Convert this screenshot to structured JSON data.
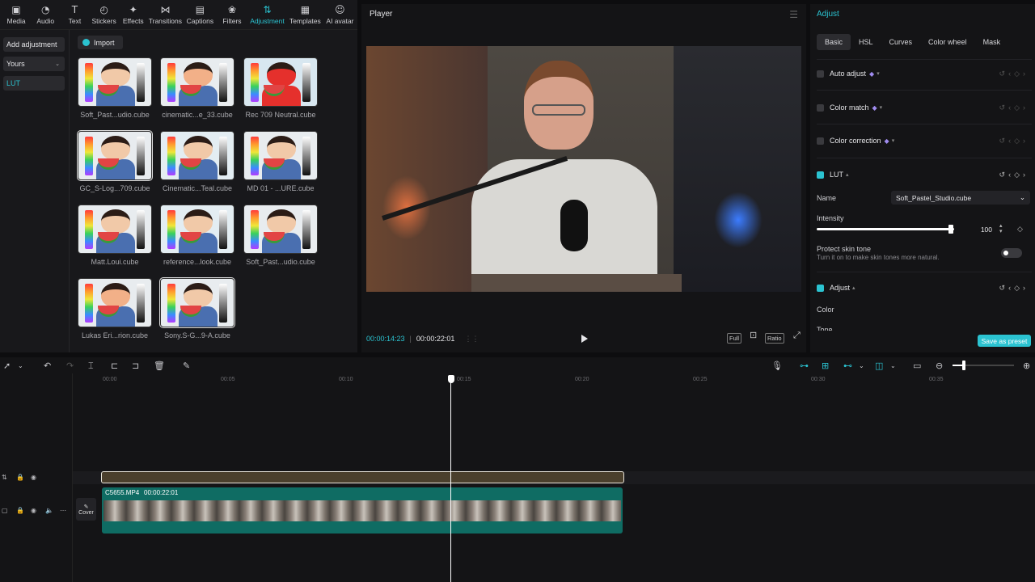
{
  "toolbar": {
    "items": [
      {
        "label": "Media",
        "icon": "▣"
      },
      {
        "label": "Audio",
        "icon": "◔"
      },
      {
        "label": "Text",
        "icon": "T"
      },
      {
        "label": "Stickers",
        "icon": "◴"
      },
      {
        "label": "Effects",
        "icon": "✦"
      },
      {
        "label": "Transitions",
        "icon": "⋈"
      },
      {
        "label": "Captions",
        "icon": "▤"
      },
      {
        "label": "Filters",
        "icon": "❀"
      },
      {
        "label": "Adjustment",
        "icon": "⇅"
      },
      {
        "label": "Templates",
        "icon": "▦"
      },
      {
        "label": "AI avatar",
        "icon": "☺"
      }
    ],
    "active": "Adjustment"
  },
  "left_panel": {
    "add_adjustment": "Add adjustment",
    "yours": "Yours",
    "lut": "LUT",
    "import": "Import",
    "luts": [
      "Soft_Past...udio.cube",
      "cinematic...e_33.cube",
      "Rec 709 Neutral.cube",
      "GC_S-Log...709.cube",
      "Cinematic...Teal.cube",
      "MD 01 - ...URE.cube",
      "Matt.Loui.cube",
      "reference...look.cube",
      "Soft_Past...udio.cube",
      "Lukas Eri...rion.cube",
      "Sony.S-G...9-A.cube"
    ]
  },
  "player": {
    "title": "Player",
    "time_current": "00:00:14:23",
    "time_total": "00:00:22:01",
    "full_label": "Full",
    "ratio_label": "Ratio"
  },
  "adjust": {
    "title": "Adjust",
    "tabs": [
      "Basic",
      "HSL",
      "Curves",
      "Color wheel",
      "Mask"
    ],
    "active_tab": "Basic",
    "auto_adjust": "Auto adjust",
    "color_match": "Color match",
    "color_correction": "Color correction",
    "lut": "LUT",
    "name_label": "Name",
    "lut_name": "Soft_Pastel_Studio.cube",
    "intensity_label": "Intensity",
    "intensity_value": "100",
    "protect_skin_tone": "Protect skin tone",
    "protect_skin_desc": "Turn it on to make skin tones more natural.",
    "adjust_section": "Adjust",
    "color_label": "Color",
    "tone_label": "Tone",
    "save_as_preset": "Save as preset"
  },
  "timeline": {
    "ticks": [
      "00:00",
      "00:05",
      "00:10",
      "00:15",
      "00:20",
      "00:25",
      "00:30",
      "00:35"
    ],
    "clip_name": "C5655.MP4",
    "clip_duration": "00:00:22:01",
    "cover_label": "Cover"
  },
  "colors": {
    "accent": "#2bc3d1",
    "clip": "#0f6c63",
    "adjust_clip": "#4a3f2c"
  }
}
